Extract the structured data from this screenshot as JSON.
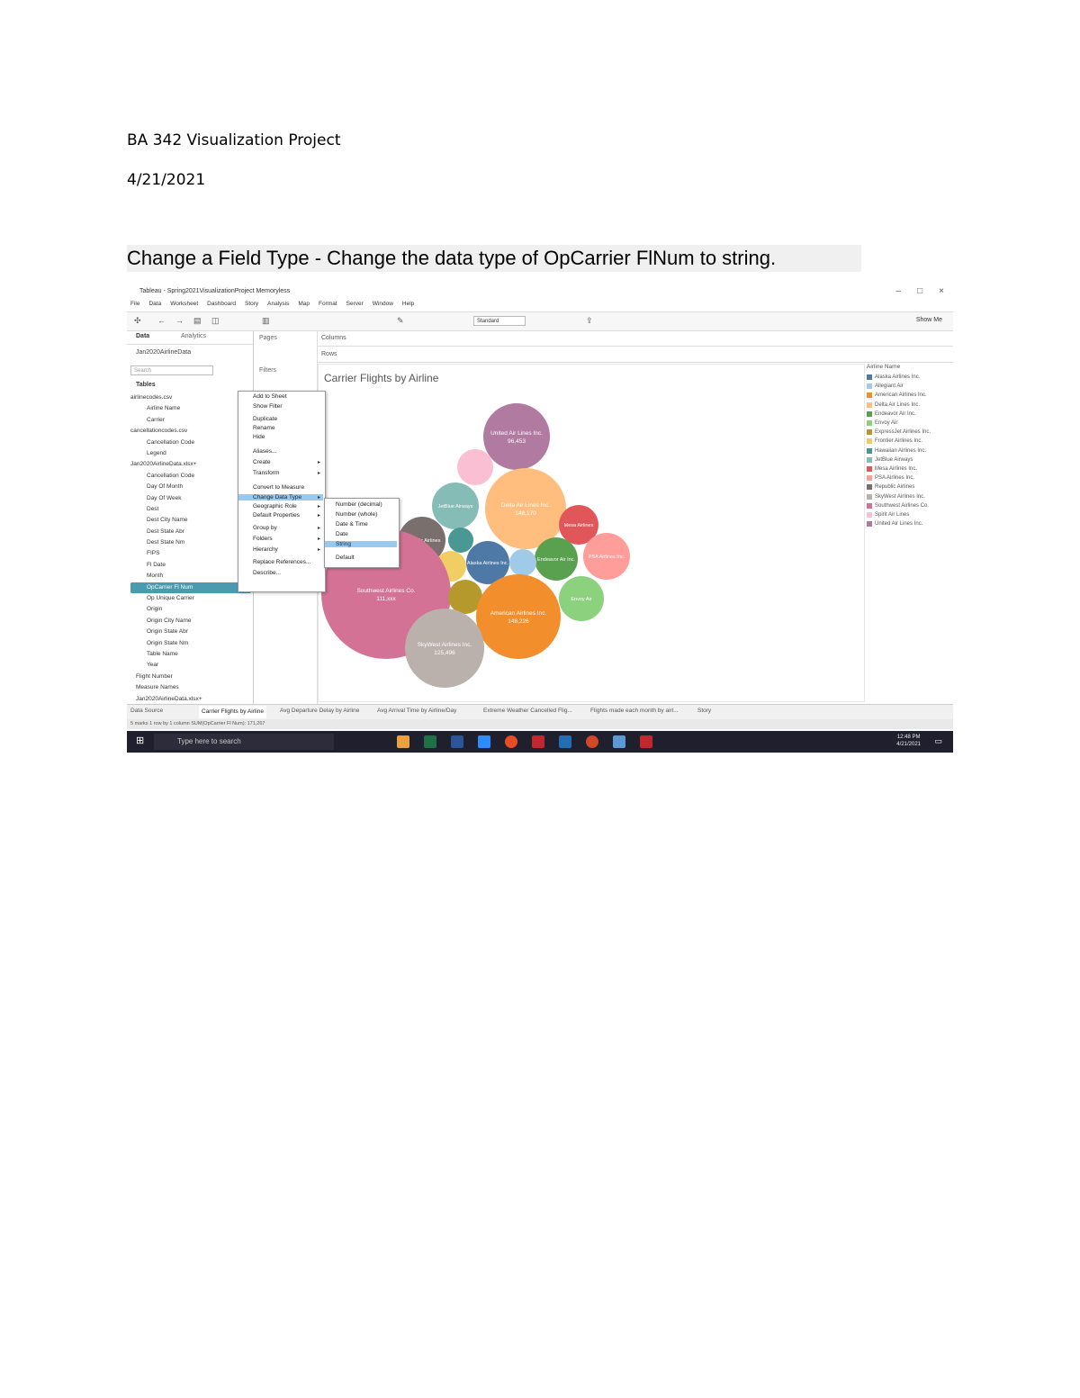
{
  "doc": {
    "title": "BA 342 Visualization Project",
    "date": "4/21/2021",
    "heading": "Change a Field Type - Change the data type of OpCarrier FlNum to string."
  },
  "screenshot": {
    "window_title": "Tableau - Spring2021VisualizationProject Memoryless",
    "menus": [
      "File",
      "Data",
      "Worksheet",
      "Dashboard",
      "Story",
      "Analysis",
      "Map",
      "Format",
      "Server",
      "Window",
      "Help"
    ],
    "toolbar": {
      "fit": "Standard",
      "show_me": "Show Me"
    },
    "left_pane": {
      "tab_data": "Data",
      "tab_analytics": "Analytics",
      "datasource": "Jan2020AirlineData",
      "search_placeholder": "Search",
      "tables_header": "Tables",
      "fields": [
        "airlinecodes.csv",
        "Airline Name",
        "Carrier",
        "cancellationcodes.csv",
        "Cancellation Code",
        "Legend",
        "Jan2020AirlineData.xlsx+",
        "Cancellation Code",
        "Day Of Month",
        "Day Of Week",
        "Dest",
        "Dest City Name",
        "Dest State Abr",
        "Dest State Nm",
        "FIPS",
        "Fl Date",
        "Month",
        "OpCarrier Fl Num",
        "Op Unique Carrier",
        "Origin",
        "Origin City Name",
        "Origin State Abr",
        "Origin State Nm",
        "Table Name",
        "Year",
        "Flight Number",
        "Measure Names",
        "Jan2020AirlineData.xlsx+"
      ],
      "selected_field": "OpCarrier Fl Num"
    },
    "shelves": {
      "pages": "Pages",
      "filters": "Filters",
      "columns": "Columns",
      "rows": "Rows"
    },
    "context_menu": [
      "Add to Sheet",
      "Show Filter",
      "Duplicate",
      "Rename",
      "Hide",
      "Aliases...",
      "Create",
      "Transform",
      "Convert to Measure",
      "Change Data Type",
      "Geographic Role",
      "Default Properties",
      "Group by",
      "Folders",
      "Hierarchy",
      "Replace References...",
      "Describe..."
    ],
    "context_highlight": "Change Data Type",
    "submenu": [
      "Number (decimal)",
      "Number (whole)",
      "Date & Time",
      "Date",
      "String",
      "Default"
    ],
    "submenu_highlight": "String",
    "viz_title": "Carrier Flights by Airline",
    "legend_title": "Airline Name",
    "legend": [
      {
        "name": "Alaska Airlines Inc.",
        "color": "#4e79a7"
      },
      {
        "name": "Allegiant Air",
        "color": "#a0cbe8"
      },
      {
        "name": "American Airlines Inc.",
        "color": "#f28e2b"
      },
      {
        "name": "Delta Air Lines Inc.",
        "color": "#ffbe7d"
      },
      {
        "name": "Endeavor Air Inc.",
        "color": "#59a14f"
      },
      {
        "name": "Envoy Air",
        "color": "#8cd17d"
      },
      {
        "name": "ExpressJet Airlines Inc.",
        "color": "#b6992d"
      },
      {
        "name": "Frontier Airlines Inc.",
        "color": "#f1ce63"
      },
      {
        "name": "Hawaiian Airlines Inc.",
        "color": "#499894"
      },
      {
        "name": "JetBlue Airways",
        "color": "#86bcb6"
      },
      {
        "name": "Mesa Airlines Inc.",
        "color": "#e15759"
      },
      {
        "name": "PSA Airlines Inc.",
        "color": "#ff9d9a"
      },
      {
        "name": "Republic Airlines",
        "color": "#79706e"
      },
      {
        "name": "SkyWest Airlines Inc.",
        "color": "#bab0ac"
      },
      {
        "name": "Southwest Airlines Co.",
        "color": "#d37295"
      },
      {
        "name": "Spirit Air Lines",
        "color": "#fabfd2"
      },
      {
        "name": "United Air Lines Inc.",
        "color": "#b07aa1"
      }
    ],
    "sheet_tabs": [
      "Data Source",
      "Carrier Flights by Airline",
      "Avg Departure Delay by Airline",
      "Avg Arrival Time by Airline/Day",
      "Extreme Weather Cancelled Flig...",
      "Flights made each month by airl...",
      "Story"
    ],
    "active_sheet": "Carrier Flights by Airline",
    "status": "5 marks    1 row by 1 column    SUM(OpCarrier Fl Num): 171,267",
    "taskbar_search": "Type here to search",
    "clock": [
      "12:48 PM",
      "4/21/2021"
    ]
  },
  "chart_data": {
    "type": "bubble",
    "title": "Carrier Flights by Airline",
    "bubbles": [
      {
        "name": "Southwest Airlines Co.",
        "label": "Southwest Airlines Co.",
        "value_label": "111,xxx",
        "color": "#d37295",
        "size": "largest"
      },
      {
        "name": "American Airlines Inc.",
        "label": "American Airlines Inc.",
        "value_label": "148,226",
        "color": "#f28e2b",
        "size": "large"
      },
      {
        "name": "Delta Air Lines Inc.",
        "label": "Delta Air Lines Inc.",
        "value_label": "148,170",
        "color": "#ffbe7d",
        "size": "large"
      },
      {
        "name": "SkyWest Airlines Inc.",
        "label": "SkyWest Airlines Inc.",
        "value_label": "125,496",
        "color": "#bab0ac",
        "size": "large"
      },
      {
        "name": "United Air Lines Inc.",
        "label": "United Air Lines Inc.",
        "value_label": "96,453",
        "color": "#b07aa1",
        "size": "medium"
      }
    ]
  }
}
